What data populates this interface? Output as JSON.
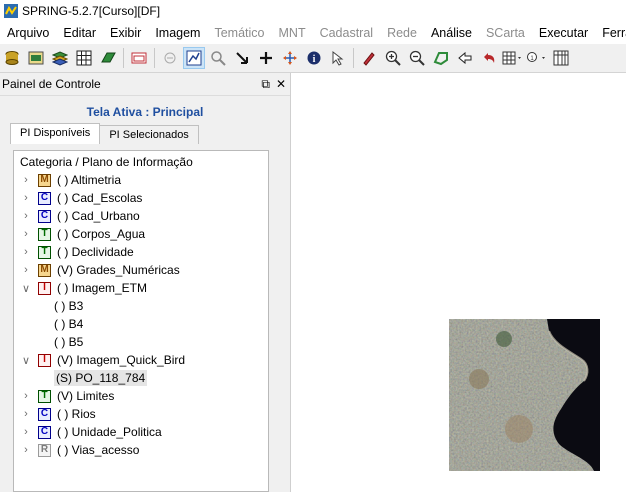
{
  "window": {
    "title": "SPRING-5.2.7[Curso][DF]"
  },
  "menu": [
    {
      "label": "Arquivo",
      "enabled": true
    },
    {
      "label": "Editar",
      "enabled": true
    },
    {
      "label": "Exibir",
      "enabled": true
    },
    {
      "label": "Imagem",
      "enabled": true
    },
    {
      "label": "Temático",
      "enabled": false
    },
    {
      "label": "MNT",
      "enabled": false
    },
    {
      "label": "Cadastral",
      "enabled": false
    },
    {
      "label": "Rede",
      "enabled": false
    },
    {
      "label": "Análise",
      "enabled": true
    },
    {
      "label": "SCarta",
      "enabled": false
    },
    {
      "label": "Executar",
      "enabled": true
    },
    {
      "label": "Ferram",
      "enabled": true
    }
  ],
  "toolbar": [
    "database-icon",
    "project-icon",
    "layers-icon",
    "grid-icon",
    "eraser-icon",
    "window-icon",
    "disabled-tool-icon",
    "active-draw-icon",
    "search-icon",
    "pointer-icon",
    "cross-icon",
    "pan-icon",
    "info-icon",
    "cursor-info-icon",
    "pencil-icon",
    "zoom-in-icon",
    "zoom-out-icon",
    "zoom-area-icon",
    "back-icon",
    "undo-icon",
    "dropdown-icon",
    "zoom-level-icon",
    "table-icon"
  ],
  "panel": {
    "title": "Painel de Controle",
    "active_screen": "Tela Ativa : Principal",
    "tabs": [
      "PI Disponíveis",
      "PI Selecionados"
    ],
    "tree_header": "Categoria / Plano de Informação",
    "categories": [
      {
        "badge": "M",
        "label": "( ) Altimetria",
        "expanded": false
      },
      {
        "badge": "C",
        "label": "( ) Cad_Escolas",
        "expanded": false
      },
      {
        "badge": "C",
        "label": "( ) Cad_Urbano",
        "expanded": false
      },
      {
        "badge": "T",
        "label": "( ) Corpos_Agua",
        "expanded": false
      },
      {
        "badge": "T",
        "label": "( ) Declividade",
        "expanded": false
      },
      {
        "badge": "M",
        "label": "(V) Grades_Numéricas",
        "expanded": false
      },
      {
        "badge": "I",
        "label": "( ) Imagem_ETM",
        "expanded": true,
        "children": [
          "( ) B3",
          "( ) B4",
          "( ) B5"
        ]
      },
      {
        "badge": "I",
        "label": "(V) Imagem_Quick_Bird",
        "expanded": true,
        "children": [
          "(S) PO_118_784"
        ]
      },
      {
        "badge": "T",
        "label": "(V) Limites",
        "expanded": false
      },
      {
        "badge": "C",
        "label": "( ) Rios",
        "expanded": false
      },
      {
        "badge": "C",
        "label": "( ) Unidade_Politica",
        "expanded": false
      },
      {
        "badge": "R",
        "label": "( ) Vias_acesso",
        "expanded": false
      }
    ]
  },
  "canvas": {
    "image": "satellite-image"
  }
}
